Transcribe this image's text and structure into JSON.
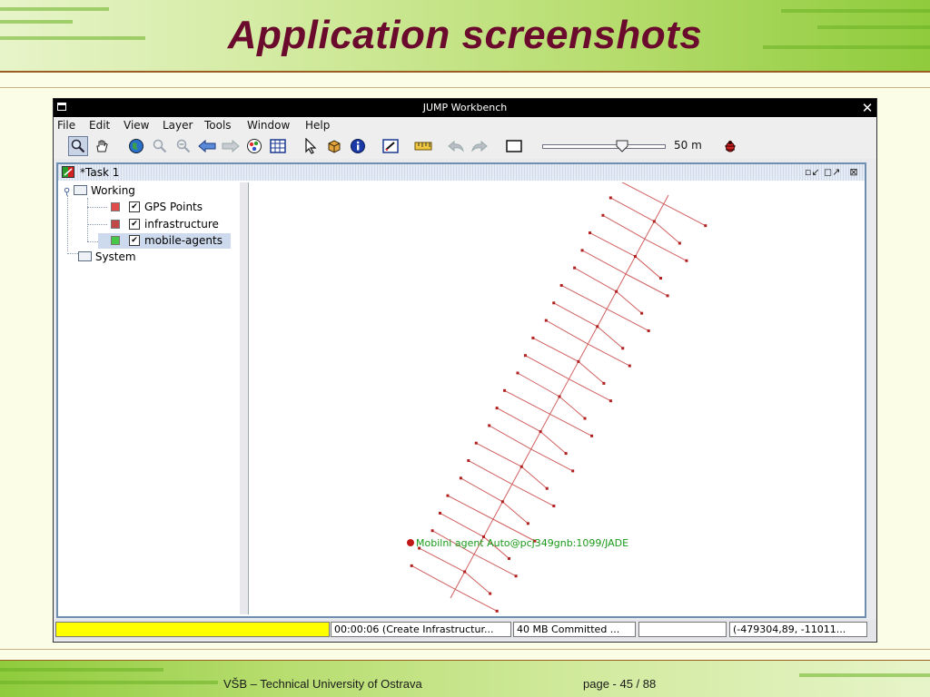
{
  "slide": {
    "title": "Application screenshots",
    "footer_left": "VŠB – Technical University of Ostrava",
    "footer_right": "page - 45 / 88"
  },
  "window": {
    "title": "JUMP Workbench",
    "menu": [
      "File",
      "Edit",
      "View",
      "Layer",
      "Tools",
      "Window",
      "Help"
    ],
    "scale_label": "50 m",
    "zoom_slider_level": 0.65
  },
  "toolbar_icons": [
    "zoom-icon",
    "pan-hand-icon",
    "zoom-extent-globe-icon",
    "zoom-in-icon",
    "zoom-out-icon",
    "previous-view-icon",
    "next-view-icon",
    "layer-palette-icon",
    "attribute-table-icon",
    "select-arrow-icon",
    "feature-box-icon",
    "info-icon",
    "edit-icon",
    "measure-ruler-icon",
    "undo-icon",
    "redo-icon",
    "frame-icon",
    "bug-icon"
  ],
  "task": {
    "title": "*Task 1"
  },
  "tree": {
    "working": "Working",
    "layers": [
      {
        "name": "GPS Points",
        "color": "#e04c4c",
        "checked": true
      },
      {
        "name": "infrastructure",
        "color": "#c04848",
        "checked": true
      },
      {
        "name": "mobile-agents",
        "color": "#48c848",
        "checked": true
      }
    ],
    "system": "System"
  },
  "map": {
    "agent_label": "Mobilni agent Auto@pcj349gnb:1099/JADE",
    "line_color": "#d06060",
    "node_color": "#b02020",
    "label_color": "#1a9a1a"
  },
  "status": {
    "time": "00:00:06 (Create Infrastructur...",
    "memory": "40 MB Committed ...",
    "coords": "(-479304,89, -11011..."
  }
}
